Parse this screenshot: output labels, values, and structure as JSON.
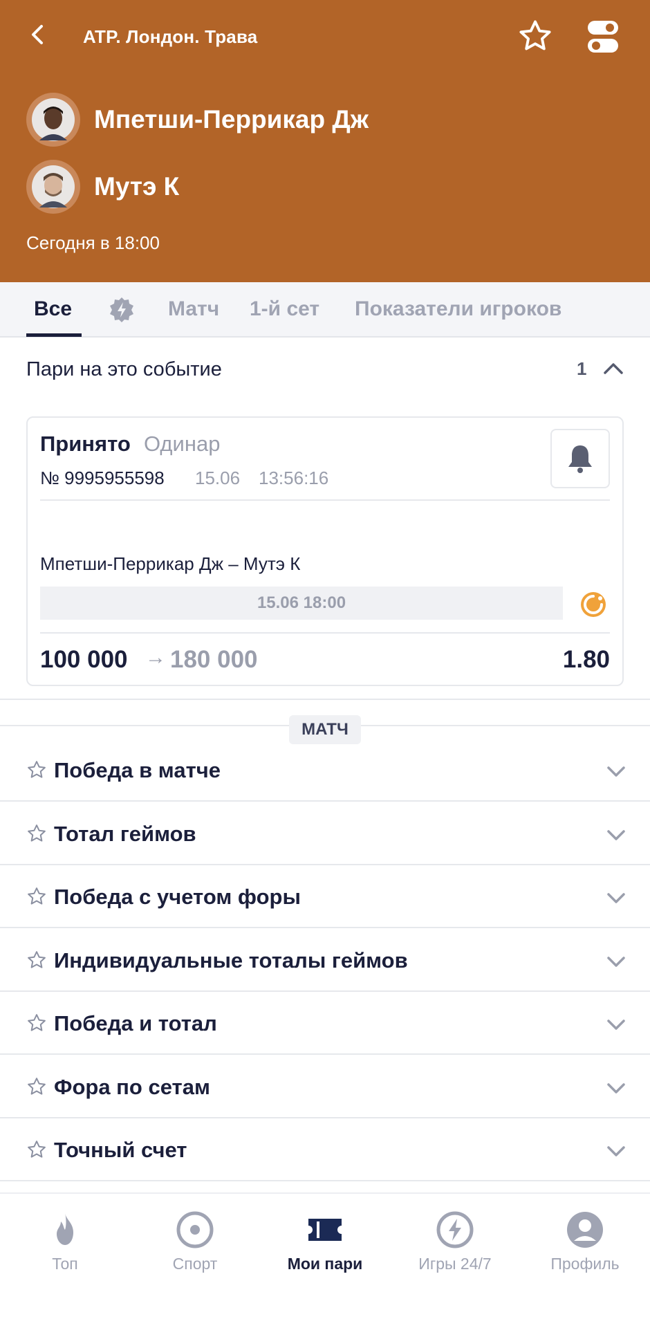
{
  "header": {
    "title": "ATP. Лондон. Трава",
    "player1": "Мпетши-Перрикар Дж",
    "player2": "Мутэ К",
    "time": "Сегодня в 18:00",
    "accent": "#b26428"
  },
  "tabs": [
    {
      "label": "Все"
    },
    {
      "label": "Матч"
    },
    {
      "label": "1-й сет"
    },
    {
      "label": "Показатели игроков"
    }
  ],
  "bets": {
    "title": "Пари на это событие",
    "count": "1",
    "card": {
      "status": "Принято",
      "type": "Одинар",
      "number": "№ 9995955598",
      "date": "15.06",
      "time": "13:56:16",
      "event": "Мпетши-Перрикар Дж – Мутэ К",
      "event_datetime": "15.06 18:00",
      "stake": "100 000",
      "arrow": "→",
      "win": "180 000",
      "odds": "1.80"
    }
  },
  "section_badge": "МАТЧ",
  "markets": [
    "Победа в матче",
    "Тотал геймов",
    "Победа с учетом форы",
    "Индивидуальные тоталы геймов",
    "Победа и тотал",
    "Фора по сетам",
    "Точный счет"
  ],
  "nav": [
    {
      "label": "Топ",
      "icon": "fire-icon"
    },
    {
      "label": "Спорт",
      "icon": "sport-icon"
    },
    {
      "label": "Мои пари",
      "icon": "ticket-icon"
    },
    {
      "label": "Игры 24/7",
      "icon": "lightning-icon"
    },
    {
      "label": "Профиль",
      "icon": "profile-icon"
    }
  ]
}
